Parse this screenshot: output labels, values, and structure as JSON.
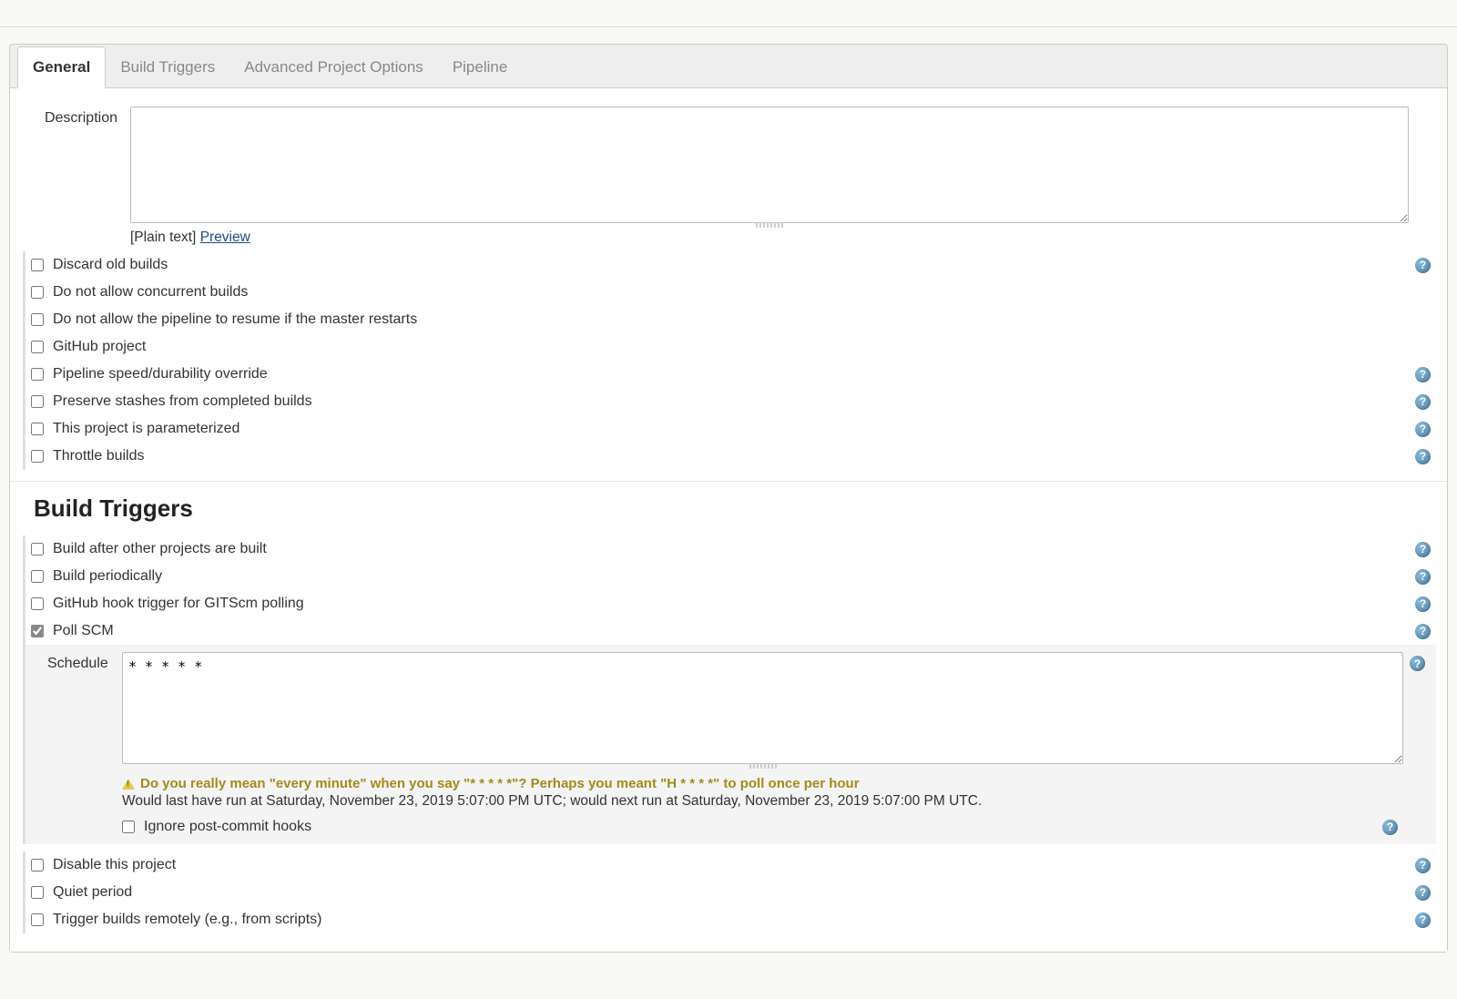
{
  "tabs": {
    "general": "General",
    "build_triggers": "Build Triggers",
    "advanced": "Advanced Project Options",
    "pipeline": "Pipeline"
  },
  "description": {
    "label": "Description",
    "value": "",
    "plain_text_prefix": "[Plain text] ",
    "preview_link": "Preview"
  },
  "general_options": {
    "discard_old_builds": "Discard old builds",
    "no_concurrent": "Do not allow concurrent builds",
    "no_resume": "Do not allow the pipeline to resume if the master restarts",
    "github_project": "GitHub project",
    "speed_durability": "Pipeline speed/durability override",
    "preserve_stashes": "Preserve stashes from completed builds",
    "parameterized": "This project is parameterized",
    "throttle": "Throttle builds"
  },
  "build_triggers_heading": "Build Triggers",
  "trigger_options": {
    "build_after": "Build after other projects are built",
    "build_periodically": "Build periodically",
    "github_hook": "GitHub hook trigger for GITScm polling",
    "poll_scm": "Poll SCM"
  },
  "schedule": {
    "label": "Schedule",
    "value": "* * * * *",
    "warning": "Do you really mean \"every minute\" when you say \"* * * * *\"? Perhaps you meant \"H * * * *\" to poll once per hour",
    "info": "Would last have run at Saturday, November 23, 2019 5:07:00 PM UTC; would next run at Saturday, November 23, 2019 5:07:00 PM UTC.",
    "ignore_hooks": "Ignore post-commit hooks"
  },
  "bottom_options": {
    "disable_project": "Disable this project",
    "quiet_period": "Quiet period",
    "trigger_remote": "Trigger builds remotely (e.g., from scripts)"
  },
  "help_glyph": "?"
}
